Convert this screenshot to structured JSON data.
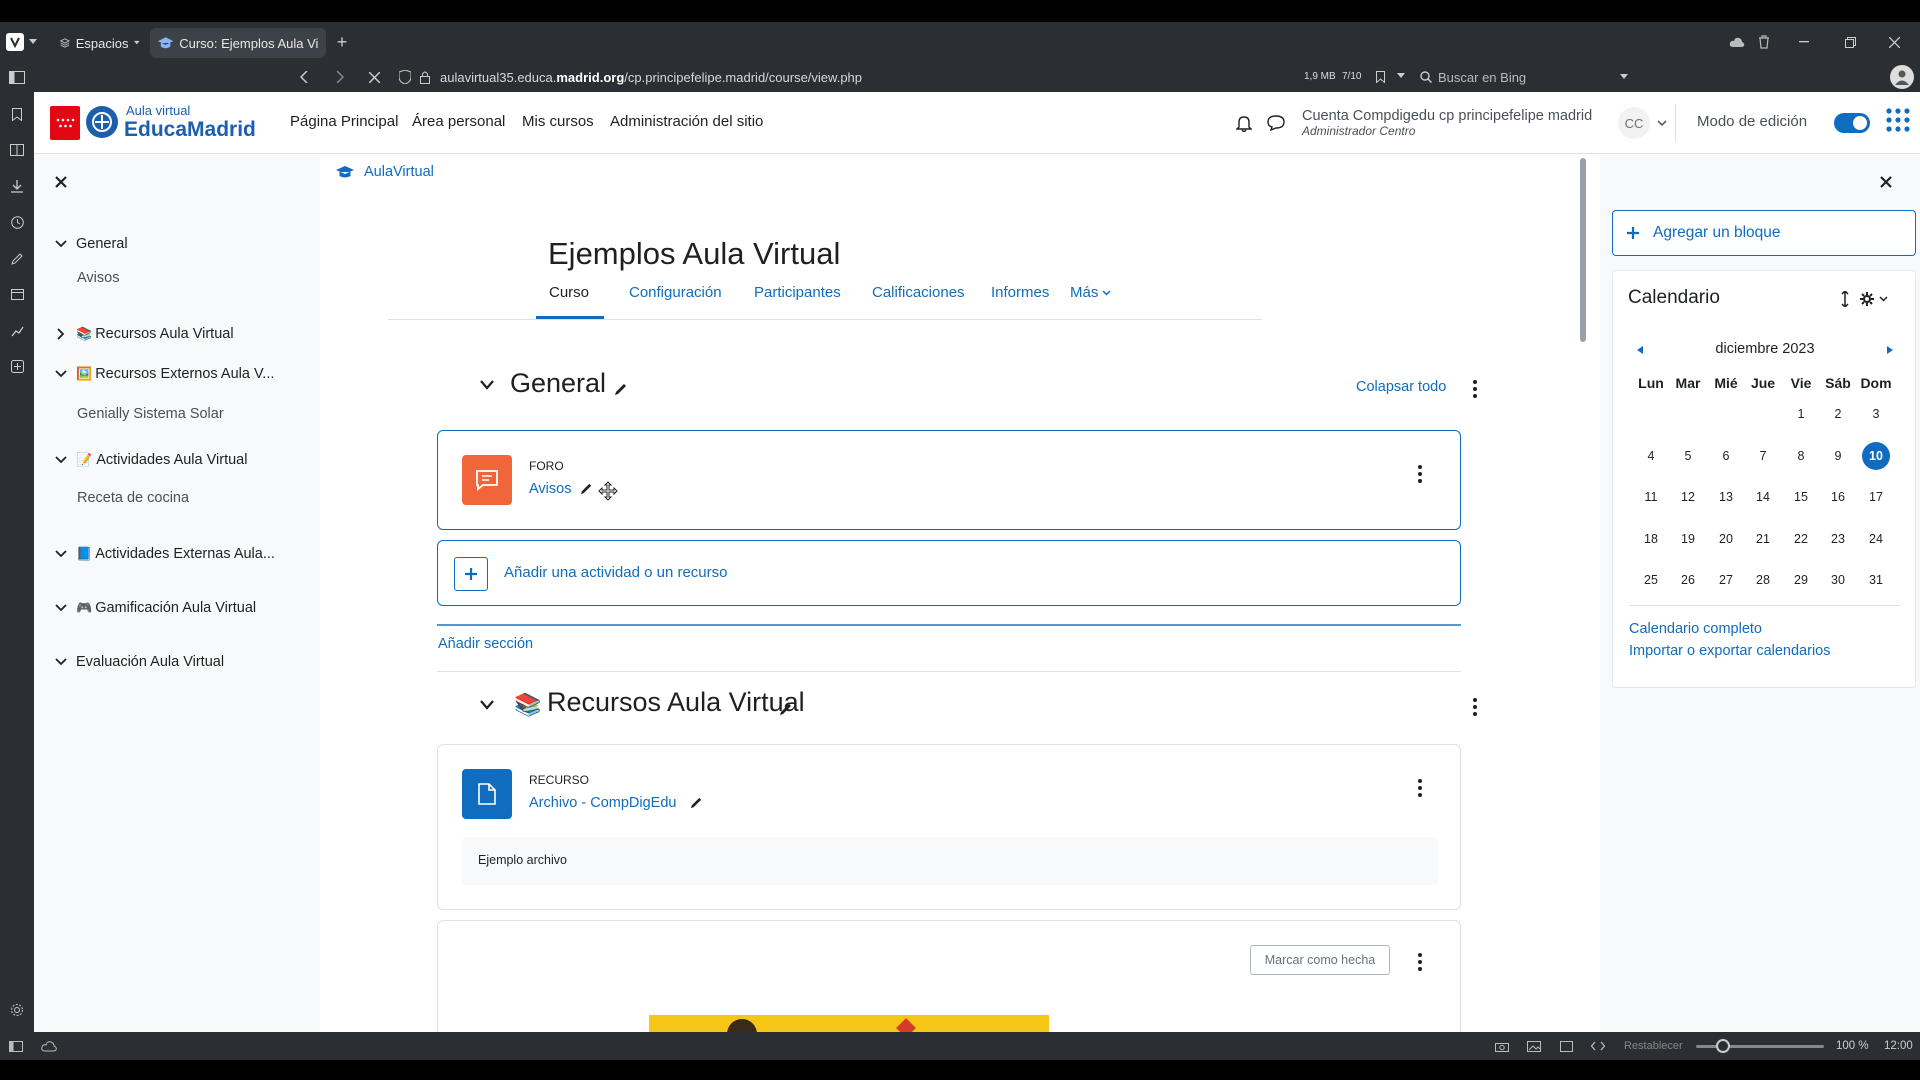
{
  "browser": {
    "workspaces_label": "Espacios",
    "tab_title": "Curso: Ejemplos Aula Virtual",
    "url_plain": "aulavirtual35.educa.",
    "url_bold": "madrid.org",
    "url_rest": "/cp.principefelipe.madrid/course/view.php",
    "page_size": "1,9 MB",
    "page_count": "7/10",
    "search_placeholder": "Buscar en Bing",
    "status_reset": "Restablecer",
    "zoom": "100 %",
    "clock": "12:00"
  },
  "navbar": {
    "logo_line1": "Aula virtual",
    "logo_line2": "EducaMadrid",
    "links": [
      "Página Principal",
      "Área personal",
      "Mis cursos",
      "Administración del sitio"
    ],
    "user_name": "Cuenta Compdigedu cp principefelipe madrid",
    "user_role": "Administrador Centro",
    "avatar_initials": "CC",
    "edit_mode_label": "Modo de edición"
  },
  "course_index": {
    "sections": [
      {
        "label": "General",
        "expanded": true,
        "emoji": ""
      },
      {
        "label": "Avisos",
        "type": "activity"
      },
      {
        "label": "Recursos Aula Virtual",
        "expanded": false,
        "emoji": "📚"
      },
      {
        "label": "Recursos Externos Aula V...",
        "expanded": true,
        "emoji": "🖼️"
      },
      {
        "label": "Genially Sistema Solar",
        "type": "activity"
      },
      {
        "label": "Actividades Aula Virtual",
        "expanded": true,
        "emoji": "📝"
      },
      {
        "label": "Receta de cocina",
        "type": "activity"
      },
      {
        "label": "Actividades Externas Aula...",
        "expanded": true,
        "emoji": "📘"
      },
      {
        "label": "Gamificación Aula Virtual",
        "expanded": true,
        "emoji": "🎮"
      },
      {
        "label": "Evaluación Aula Virtual",
        "expanded": true,
        "emoji": ""
      }
    ]
  },
  "main": {
    "breadcrumb": "AulaVirtual",
    "course_title": "Ejemplos Aula Virtual",
    "tabs": [
      "Curso",
      "Configuración",
      "Participantes",
      "Calificaciones",
      "Informes",
      "Más"
    ],
    "collapse_all": "Colapsar todo",
    "section_general": "General",
    "forum_type": "FORO",
    "forum_name": "Avisos",
    "add_activity": "Añadir una actividad o un recurso",
    "add_section": "Añadir sección",
    "section_recursos": "Recursos Aula Virtual",
    "section_recursos_emoji": "📚",
    "resource_type": "RECURSO",
    "resource_name": "Archivo - CompDigEdu",
    "resource_desc": "Ejemplo archivo",
    "mark_done": "Marcar como hecha"
  },
  "right_drawer": {
    "add_block": "Agregar un bloque",
    "calendar_title": "Calendario",
    "month": "diciembre 2023",
    "weekdays": [
      "Lun",
      "Mar",
      "Mié",
      "Jue",
      "Vie",
      "Sáb",
      "Dom"
    ],
    "weeks": [
      [
        "",
        "",
        "",
        "",
        "1",
        "2",
        "3"
      ],
      [
        "4",
        "5",
        "6",
        "7",
        "8",
        "9",
        "10"
      ],
      [
        "11",
        "12",
        "13",
        "14",
        "15",
        "16",
        "17"
      ],
      [
        "18",
        "19",
        "20",
        "21",
        "22",
        "23",
        "24"
      ],
      [
        "25",
        "26",
        "27",
        "28",
        "29",
        "30",
        "31"
      ]
    ],
    "today": "10",
    "full_calendar": "Calendario completo",
    "import_export": "Importar o exportar calendarios"
  },
  "colors": {
    "primary": "#0f6cbf",
    "forum_icon": "#f0663a",
    "resource_icon": "#0f6cbf",
    "brand_red": "#e30613",
    "browser_chrome": "#2b2e33"
  }
}
